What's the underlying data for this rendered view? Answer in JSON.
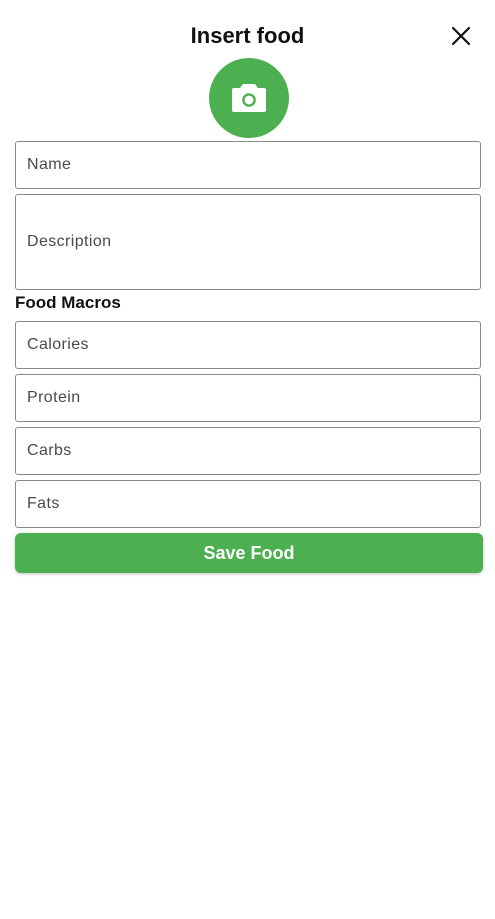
{
  "header": {
    "title": "Insert food",
    "close_icon": "close-icon"
  },
  "photo": {
    "icon": "camera-icon",
    "color": "#4caf50"
  },
  "form": {
    "name_placeholder": "Name",
    "description_placeholder": "Description"
  },
  "macros": {
    "title": "Food Macros",
    "calories_placeholder": "Calories",
    "protein_placeholder": "Protein",
    "carbs_placeholder": "Carbs",
    "fats_placeholder": "Fats"
  },
  "actions": {
    "save_label": "Save Food",
    "accent_color": "#4caf50"
  }
}
